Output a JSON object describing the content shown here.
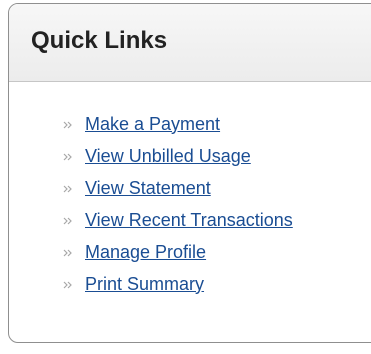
{
  "quick_links": {
    "title": "Quick Links",
    "bullet_icon": "double-chevron-right-icon",
    "link_color": "#1a4d93",
    "items": [
      {
        "label": "Make a Payment"
      },
      {
        "label": "View Unbilled Usage"
      },
      {
        "label": "View Statement"
      },
      {
        "label": "View Recent Transactions"
      },
      {
        "label": "Manage Profile"
      },
      {
        "label": "Print Summary"
      }
    ]
  }
}
